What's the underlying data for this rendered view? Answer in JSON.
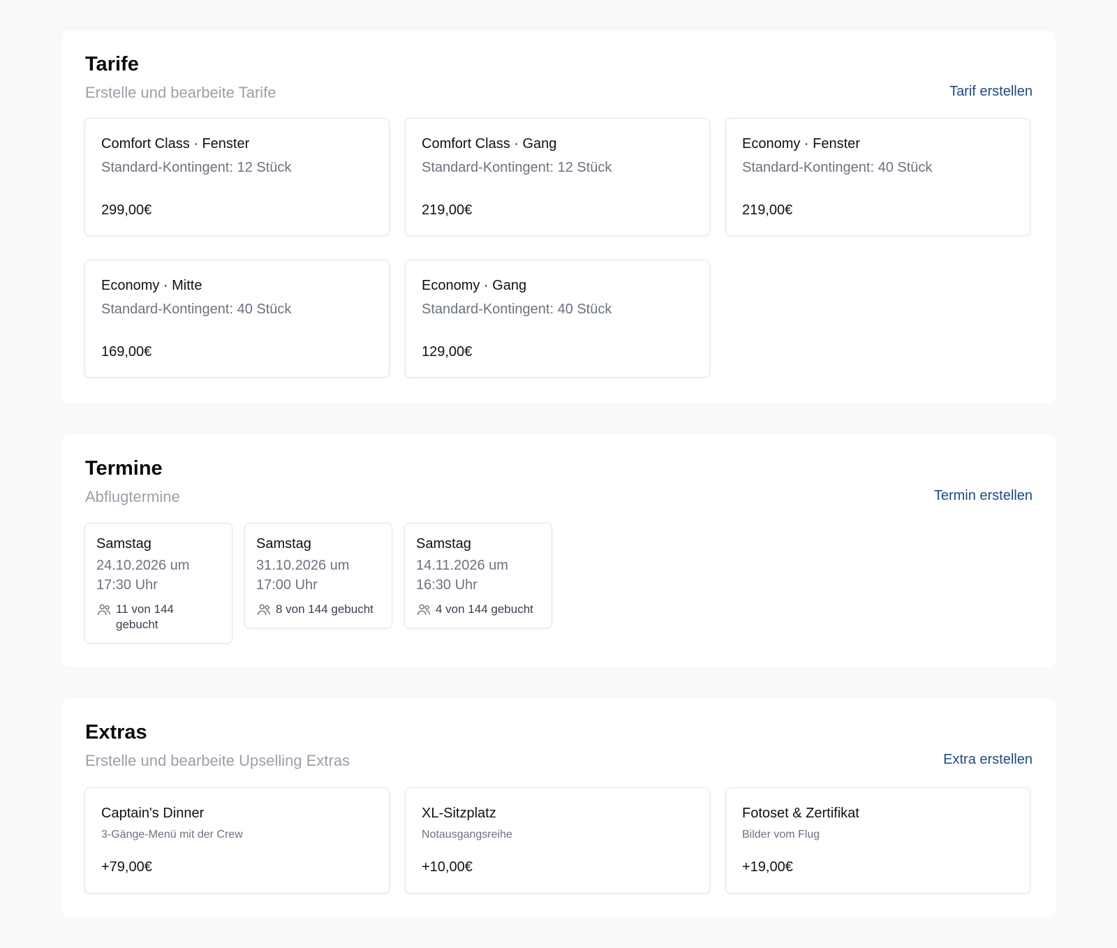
{
  "tarife": {
    "title": "Tarife",
    "subtitle": "Erstelle und bearbeite Tarife",
    "action": "Tarif erstellen",
    "items": [
      {
        "title": "Comfort Class · Fenster",
        "quota": "Standard-Kontingent: 12 Stück",
        "price": "299,00€"
      },
      {
        "title": "Comfort Class · Gang",
        "quota": "Standard-Kontingent: 12 Stück",
        "price": "219,00€"
      },
      {
        "title": "Economy · Fenster",
        "quota": "Standard-Kontingent: 40 Stück",
        "price": "219,00€"
      },
      {
        "title": "Economy · Mitte",
        "quota": "Standard-Kontingent: 40 Stück",
        "price": "169,00€"
      },
      {
        "title": "Economy · Gang",
        "quota": "Standard-Kontingent: 40 Stück",
        "price": "129,00€"
      }
    ]
  },
  "termine": {
    "title": "Termine",
    "subtitle": "Abflugtermine",
    "action": "Termin erstellen",
    "items": [
      {
        "day": "Samstag",
        "datetime": "24.10.2026 um 17:30 Uhr",
        "booked": "11 von 144 gebucht",
        "icon": "users-icon"
      },
      {
        "day": "Samstag",
        "datetime": "31.10.2026 um 17:00 Uhr",
        "booked": "8 von 144 gebucht",
        "icon": "users-icon"
      },
      {
        "day": "Samstag",
        "datetime": "14.11.2026 um 16:30 Uhr",
        "booked": "4 von 144 gebucht",
        "icon": "users-icon"
      }
    ]
  },
  "extras": {
    "title": "Extras",
    "subtitle": "Erstelle und bearbeite Upselling Extras",
    "action": "Extra erstellen",
    "items": [
      {
        "title": "Captain's Dinner",
        "desc": "3-Gänge-Menü mit der Crew",
        "price": "+79,00€"
      },
      {
        "title": "XL-Sitzplatz",
        "desc": "Notausgangsreihe",
        "price": "+10,00€"
      },
      {
        "title": "Fotoset & Zertifikat",
        "desc": "Bilder vom Flug",
        "price": "+19,00€"
      }
    ]
  },
  "colors": {
    "page_background": "#f8f9fb",
    "link": "#1d4a86",
    "muted_text": "#6b7280",
    "subtitle": "#9aa0aa"
  }
}
